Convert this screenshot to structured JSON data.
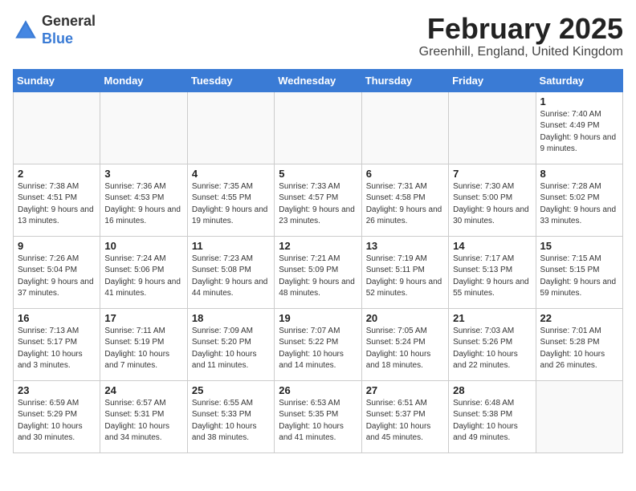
{
  "header": {
    "logo_line1": "General",
    "logo_line2": "Blue",
    "title": "February 2025",
    "subtitle": "Greenhill, England, United Kingdom"
  },
  "days_of_week": [
    "Sunday",
    "Monday",
    "Tuesday",
    "Wednesday",
    "Thursday",
    "Friday",
    "Saturday"
  ],
  "weeks": [
    [
      {
        "day": "",
        "info": ""
      },
      {
        "day": "",
        "info": ""
      },
      {
        "day": "",
        "info": ""
      },
      {
        "day": "",
        "info": ""
      },
      {
        "day": "",
        "info": ""
      },
      {
        "day": "",
        "info": ""
      },
      {
        "day": "1",
        "info": "Sunrise: 7:40 AM\nSunset: 4:49 PM\nDaylight: 9 hours and 9 minutes."
      }
    ],
    [
      {
        "day": "2",
        "info": "Sunrise: 7:38 AM\nSunset: 4:51 PM\nDaylight: 9 hours and 13 minutes."
      },
      {
        "day": "3",
        "info": "Sunrise: 7:36 AM\nSunset: 4:53 PM\nDaylight: 9 hours and 16 minutes."
      },
      {
        "day": "4",
        "info": "Sunrise: 7:35 AM\nSunset: 4:55 PM\nDaylight: 9 hours and 19 minutes."
      },
      {
        "day": "5",
        "info": "Sunrise: 7:33 AM\nSunset: 4:57 PM\nDaylight: 9 hours and 23 minutes."
      },
      {
        "day": "6",
        "info": "Sunrise: 7:31 AM\nSunset: 4:58 PM\nDaylight: 9 hours and 26 minutes."
      },
      {
        "day": "7",
        "info": "Sunrise: 7:30 AM\nSunset: 5:00 PM\nDaylight: 9 hours and 30 minutes."
      },
      {
        "day": "8",
        "info": "Sunrise: 7:28 AM\nSunset: 5:02 PM\nDaylight: 9 hours and 33 minutes."
      }
    ],
    [
      {
        "day": "9",
        "info": "Sunrise: 7:26 AM\nSunset: 5:04 PM\nDaylight: 9 hours and 37 minutes."
      },
      {
        "day": "10",
        "info": "Sunrise: 7:24 AM\nSunset: 5:06 PM\nDaylight: 9 hours and 41 minutes."
      },
      {
        "day": "11",
        "info": "Sunrise: 7:23 AM\nSunset: 5:08 PM\nDaylight: 9 hours and 44 minutes."
      },
      {
        "day": "12",
        "info": "Sunrise: 7:21 AM\nSunset: 5:09 PM\nDaylight: 9 hours and 48 minutes."
      },
      {
        "day": "13",
        "info": "Sunrise: 7:19 AM\nSunset: 5:11 PM\nDaylight: 9 hours and 52 minutes."
      },
      {
        "day": "14",
        "info": "Sunrise: 7:17 AM\nSunset: 5:13 PM\nDaylight: 9 hours and 55 minutes."
      },
      {
        "day": "15",
        "info": "Sunrise: 7:15 AM\nSunset: 5:15 PM\nDaylight: 9 hours and 59 minutes."
      }
    ],
    [
      {
        "day": "16",
        "info": "Sunrise: 7:13 AM\nSunset: 5:17 PM\nDaylight: 10 hours and 3 minutes."
      },
      {
        "day": "17",
        "info": "Sunrise: 7:11 AM\nSunset: 5:19 PM\nDaylight: 10 hours and 7 minutes."
      },
      {
        "day": "18",
        "info": "Sunrise: 7:09 AM\nSunset: 5:20 PM\nDaylight: 10 hours and 11 minutes."
      },
      {
        "day": "19",
        "info": "Sunrise: 7:07 AM\nSunset: 5:22 PM\nDaylight: 10 hours and 14 minutes."
      },
      {
        "day": "20",
        "info": "Sunrise: 7:05 AM\nSunset: 5:24 PM\nDaylight: 10 hours and 18 minutes."
      },
      {
        "day": "21",
        "info": "Sunrise: 7:03 AM\nSunset: 5:26 PM\nDaylight: 10 hours and 22 minutes."
      },
      {
        "day": "22",
        "info": "Sunrise: 7:01 AM\nSunset: 5:28 PM\nDaylight: 10 hours and 26 minutes."
      }
    ],
    [
      {
        "day": "23",
        "info": "Sunrise: 6:59 AM\nSunset: 5:29 PM\nDaylight: 10 hours and 30 minutes."
      },
      {
        "day": "24",
        "info": "Sunrise: 6:57 AM\nSunset: 5:31 PM\nDaylight: 10 hours and 34 minutes."
      },
      {
        "day": "25",
        "info": "Sunrise: 6:55 AM\nSunset: 5:33 PM\nDaylight: 10 hours and 38 minutes."
      },
      {
        "day": "26",
        "info": "Sunrise: 6:53 AM\nSunset: 5:35 PM\nDaylight: 10 hours and 41 minutes."
      },
      {
        "day": "27",
        "info": "Sunrise: 6:51 AM\nSunset: 5:37 PM\nDaylight: 10 hours and 45 minutes."
      },
      {
        "day": "28",
        "info": "Sunrise: 6:48 AM\nSunset: 5:38 PM\nDaylight: 10 hours and 49 minutes."
      },
      {
        "day": "",
        "info": ""
      }
    ]
  ]
}
